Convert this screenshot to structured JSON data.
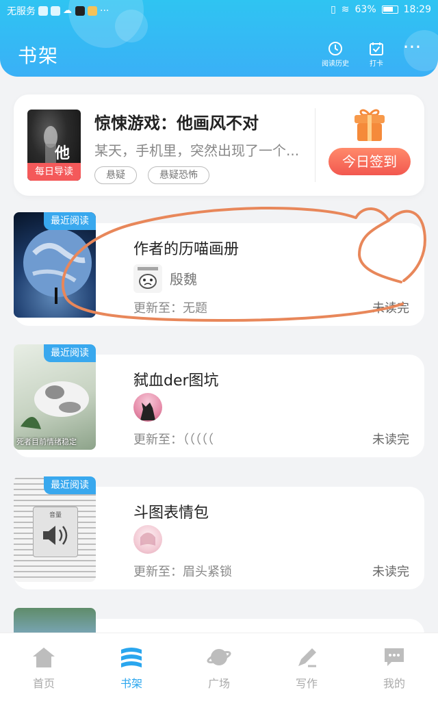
{
  "status_bar": {
    "carrier": "无服务",
    "battery": "63%",
    "time": "18:29"
  },
  "header": {
    "title": "书架",
    "history_label": "阅读历史",
    "checkin_label": "打卡",
    "more": "···"
  },
  "featured": {
    "title": "惊悚游戏：他画风不对",
    "description": "某天，手机里，突然出现了一个...",
    "badge": "每日导读",
    "cover_text": "他",
    "tags": [
      "悬疑",
      "悬疑恐怖"
    ],
    "checkin_button": "今日签到"
  },
  "books": [
    {
      "title": "作者的历喵画册",
      "author": "殷魏",
      "update": "更新至：无题",
      "status": "未读完",
      "badge": "最近阅读"
    },
    {
      "title": "弑血der图坑",
      "author": "",
      "update": "更新至：（（（（（",
      "status": "未读完",
      "badge": "最近阅读",
      "cover_text": "死者目前情绪稳定"
    },
    {
      "title": "斗图表情包",
      "author": "",
      "update": "更新至：眉头紧锁",
      "status": "未读完",
      "badge": "最近阅读",
      "cover_text": "音量"
    }
  ],
  "nav": [
    {
      "label": "首页",
      "active": false
    },
    {
      "label": "书架",
      "active": true
    },
    {
      "label": "广场",
      "active": false
    },
    {
      "label": "写作",
      "active": false
    },
    {
      "label": "我的",
      "active": false
    }
  ],
  "colors": {
    "header_blue": "#2fc4f2",
    "accent_blue": "#2aa6ee",
    "badge_red": "#f4595a",
    "doodle_orange": "#e8875a"
  }
}
